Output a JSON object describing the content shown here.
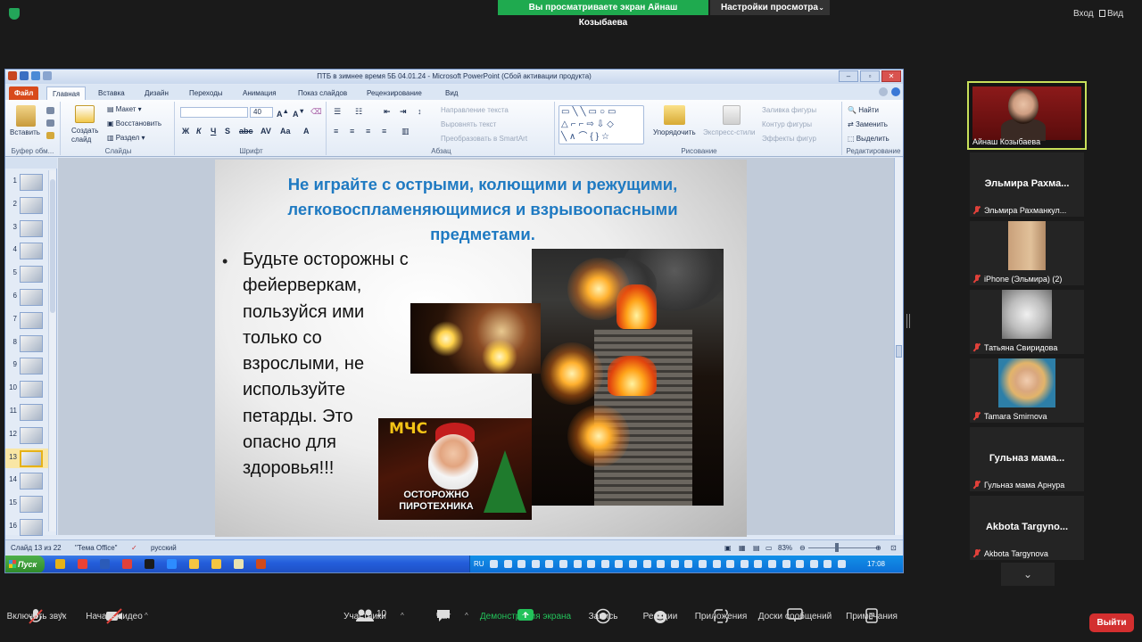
{
  "zoom_top": {
    "banner": "Вы просматриваете экран Айнаш Козыбаева",
    "view_settings": "Настройки просмотра",
    "enter": "Вход",
    "view": "Вид"
  },
  "ppt": {
    "title": "ПТБ в зимнее время 5Б 04.01.24  -  Microsoft PowerPoint (Сбой активации продукта)",
    "tabs": [
      "Файл",
      "Главная",
      "Вставка",
      "Дизайн",
      "Переходы",
      "Анимация",
      "Показ слайдов",
      "Рецензирование",
      "Вид"
    ],
    "ribbon": {
      "paste": "Вставить",
      "create_slide": "Создать\nслайд",
      "layout": "Макет",
      "reset": "Восстановить",
      "section": "Раздел",
      "font_size": "40",
      "text_direction": "Направление текста",
      "align_text": "Выровнять текст",
      "smartart": "Преобразовать в SmartArt",
      "arrange": "Упорядочить",
      "quick_styles": "Экспресс-стили",
      "shape_fill": "Заливка фигуры",
      "shape_outline": "Контур фигуры",
      "shape_effects": "Эффекты фигур",
      "find": "Найти",
      "replace": "Заменить",
      "select": "Выделить",
      "groups": {
        "clipboard": "Буфер обм...",
        "slides": "Слайды",
        "font": "Шрифт",
        "paragraph": "Абзац",
        "drawing": "Рисование",
        "editing": "Редактирование"
      }
    },
    "thumbnails": [
      "1",
      "2",
      "3",
      "4",
      "5",
      "6",
      "7",
      "8",
      "9",
      "10",
      "11",
      "12",
      "13",
      "14",
      "15",
      "16"
    ],
    "selected_slide": 13,
    "slide": {
      "title": "Не играйте с острыми, колющими и режущими, легковоспламеняющимися  и взрывоопасными предметами.",
      "bullet": "Будьте осторожны с фейерверкам, пользуйся ими только со взрослыми, не используйте петарды. Это опасно для здоровья!!!",
      "mchs_logo": "МЧС",
      "mchs_caption": "ОСТОРОЖНО\nПИРОТЕХНИКА"
    },
    "status": {
      "slide_count": "Слайд 13 из 22",
      "theme": "\"Тема Office\"",
      "language": "русский",
      "zoom": "83%"
    },
    "taskbar": {
      "start": "Пуск",
      "lang": "RU",
      "clock": "17:08"
    }
  },
  "participants": {
    "presenter_name": "Айнаш Козыбаева",
    "tiles": [
      {
        "title": "Эльмира  Рахма...",
        "name": "Эльмира Рахманкул..."
      },
      {
        "title": "",
        "name": "iPhone (Эльмира) (2)"
      },
      {
        "title": "",
        "name": "Татьяна Свиридова"
      },
      {
        "title": "",
        "name": "Tamara Smirnova"
      },
      {
        "title": "Гульназ  мама...",
        "name": "Гульназ мама Арнура"
      },
      {
        "title": "Akbota  Targyno...",
        "name": "Akbota Targynova"
      }
    ]
  },
  "zoom_bottom": {
    "mute": "Включить звук",
    "video": "Начать видео",
    "participants": "Участники",
    "participants_count": "10",
    "chat": "Чат",
    "share": "Демонстрация экрана",
    "record": "Запись",
    "reactions": "Реакции",
    "apps": "Приложения",
    "whiteboards": "Доски сообщений",
    "notes": "Примечания",
    "leave": "Выйти"
  },
  "colors": {
    "zoom_green": "#1faa4f",
    "slide_title_blue": "#1f7ac2",
    "leave_red": "#d32f2f",
    "active_speaker": "#c8e05a"
  }
}
